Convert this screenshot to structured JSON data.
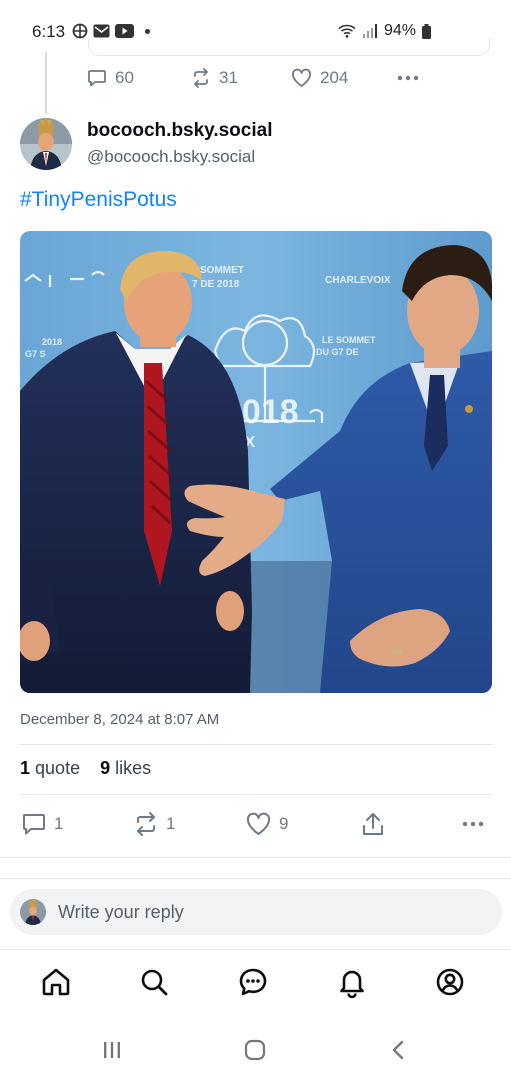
{
  "status_bar": {
    "time": "6:13",
    "battery": "94%"
  },
  "prev_post": {
    "replies": "60",
    "reposts": "31",
    "likes": "204"
  },
  "post": {
    "author_name": "bocooch.bsky.social",
    "author_handle": "@bocooch.bsky.social",
    "text": "#TinyPenisPotus",
    "date": "December 8, 2024 at 8:07 AM",
    "quotes_count": "1",
    "quotes_label": "quote",
    "likes_count": "9",
    "likes_label": "likes",
    "actions": {
      "replies": "1",
      "reposts": "1",
      "likes": "9"
    },
    "image_signage": {
      "sommet": "SOMMET",
      "date_fr": "7 DE 2018",
      "charlevoix": "CHARLEVOIX",
      "le_sommet": "LE SOMMET",
      "du_g7": "DU G7 DE",
      "year_left": "2018",
      "g7": "G7 S",
      "big_year": "2018",
      "ix": "IX"
    }
  },
  "reply": {
    "placeholder": "Write your reply"
  },
  "colors": {
    "accent": "#1083fe",
    "muted": "#6f7a86"
  }
}
